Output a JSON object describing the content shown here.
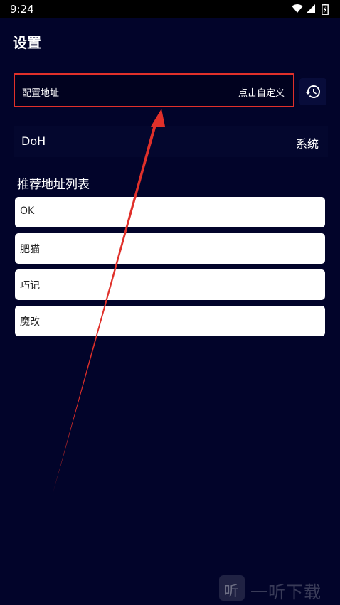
{
  "status_bar": {
    "time": "9:24",
    "icons": [
      "wifi-icon",
      "signal-icon",
      "battery-icon"
    ]
  },
  "page": {
    "title": "设置"
  },
  "address": {
    "label": "配置地址",
    "hint": "点击自定义"
  },
  "history_button": {
    "icon": "history-icon"
  },
  "doh": {
    "label": "DoH",
    "value": "系统"
  },
  "recommended": {
    "title": "推荐地址列表",
    "items": [
      {
        "label": "OK"
      },
      {
        "label": "肥猫"
      },
      {
        "label": "巧记"
      },
      {
        "label": "魔改"
      }
    ]
  },
  "watermark": {
    "logo_glyph": "听",
    "text": "一听下载"
  },
  "colors": {
    "background": "#02042a",
    "highlight_border": "#e0302a",
    "annotation_arrow": "#e0302a",
    "card_background": "#ffffff"
  }
}
